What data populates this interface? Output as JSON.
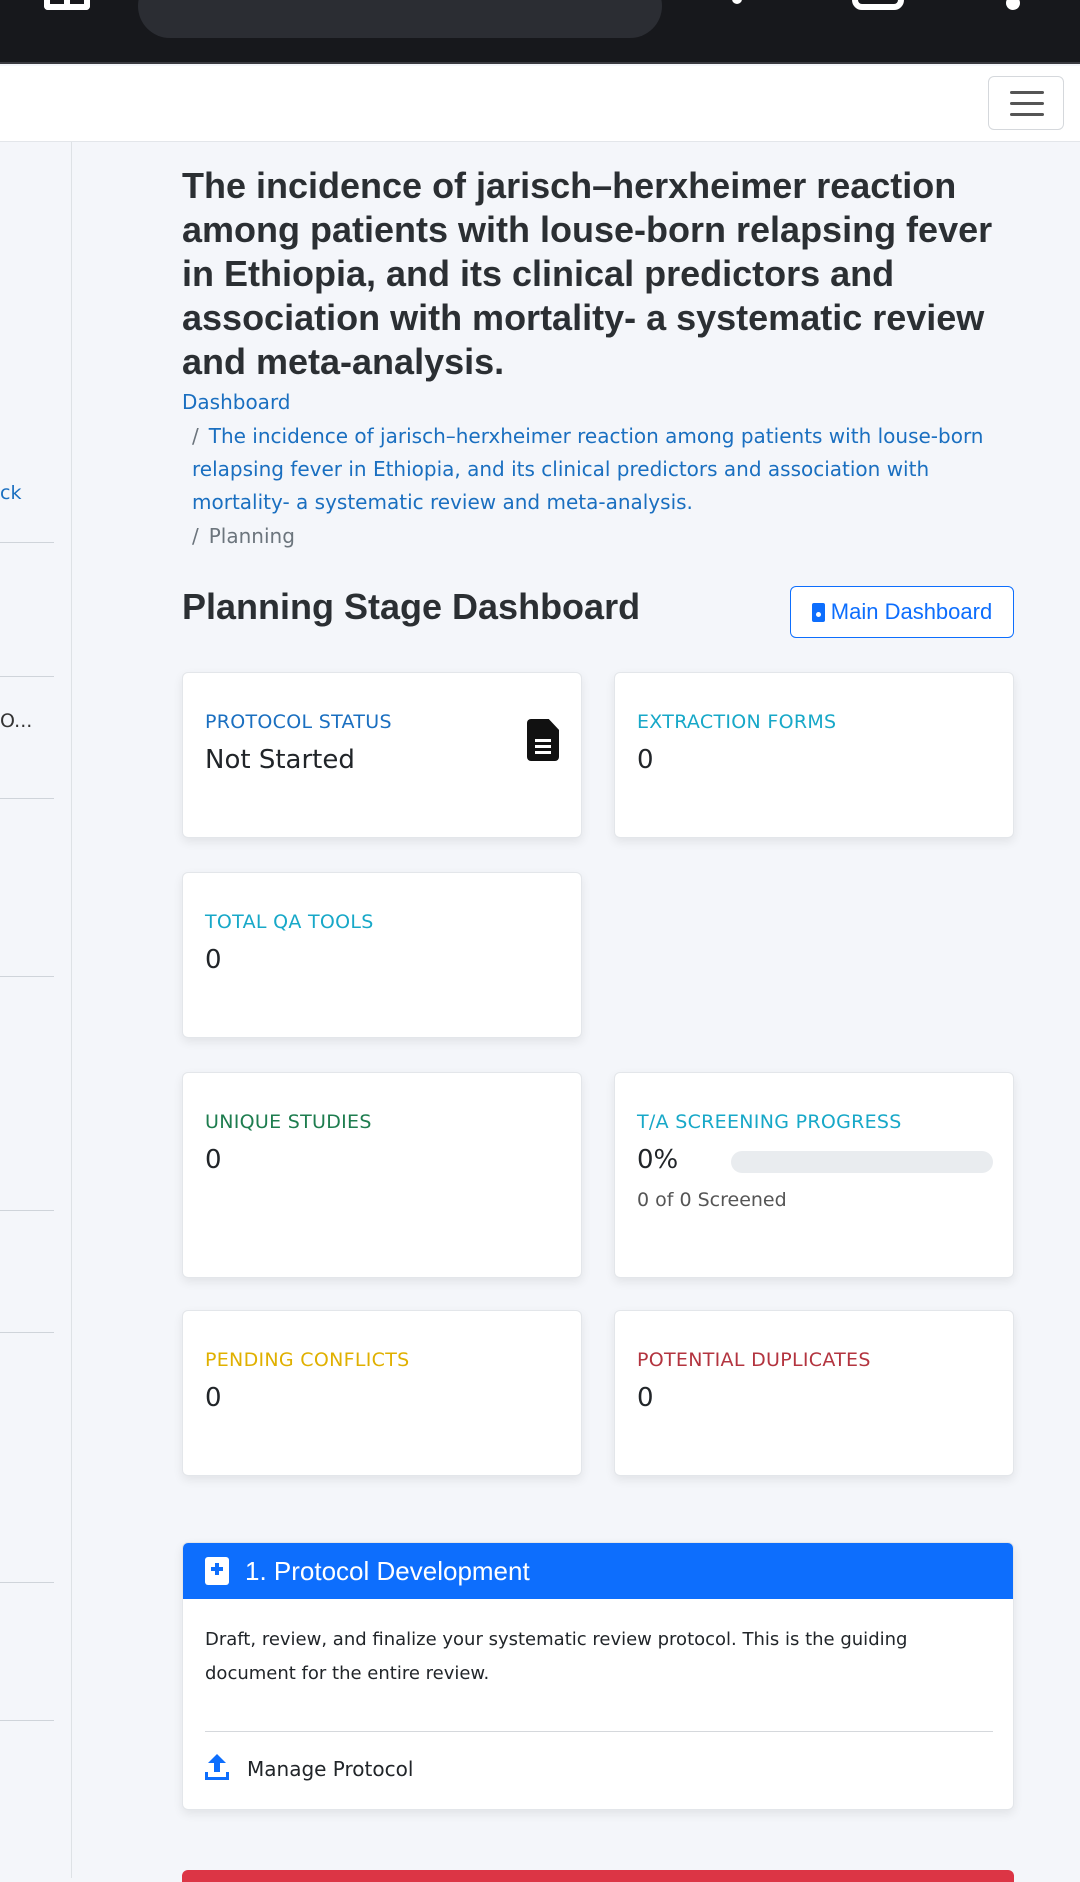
{
  "sidebar": {
    "fragment_top": "ck",
    "fragment_mid": "O..."
  },
  "page": {
    "title": "The incidence of jarisch–herxheimer reaction among patients with louse-born relapsing fever in Ethiopia, and its clinical predictors and association with mortality- a systematic review and meta-analysis."
  },
  "breadcrumb": {
    "home": "Dashboard",
    "separator": "/",
    "project": "The incidence of jarisch–herxheimer reaction among patients with louse-born relapsing fever in Ethiopia, and its clinical predictors and association with mortality- a systematic review and meta-analysis.",
    "current": "Planning"
  },
  "dashboard": {
    "heading": "Planning Stage Dashboard",
    "main_button": "Main Dashboard"
  },
  "cards": {
    "protocol_status": {
      "label": "PROTOCOL STATUS",
      "value": "Not Started",
      "color": "#1a6fc0",
      "icon": "file-text-icon"
    },
    "extraction_forms": {
      "label": "EXTRACTION FORMS",
      "value": "0",
      "color": "#17a8c8"
    },
    "total_qa_tools": {
      "label": "TOTAL QA TOOLS",
      "value": "0",
      "color": "#17a8c8"
    },
    "unique_studies": {
      "label": "UNIQUE STUDIES",
      "value": "0",
      "color": "#1e7d4f"
    },
    "ta_screening": {
      "label": "T/A SCREENING PROGRESS",
      "value": "0%",
      "progress": 0,
      "sub": "0 of 0 Screened",
      "color": "#17a8c8"
    },
    "pending_conflicts": {
      "label": "PENDING CONFLICTS",
      "value": "0",
      "color": "#e0b000"
    },
    "potential_duplicates": {
      "label": "POTENTIAL DUPLICATES",
      "value": "0",
      "color": "#b3343f"
    }
  },
  "protocol_section": {
    "title": "1. Protocol Development",
    "description": "Draft, review, and finalize your systematic review protocol. This is the guiding document for the entire review.",
    "action": "Manage Protocol",
    "header_color": "#0d6efd"
  }
}
